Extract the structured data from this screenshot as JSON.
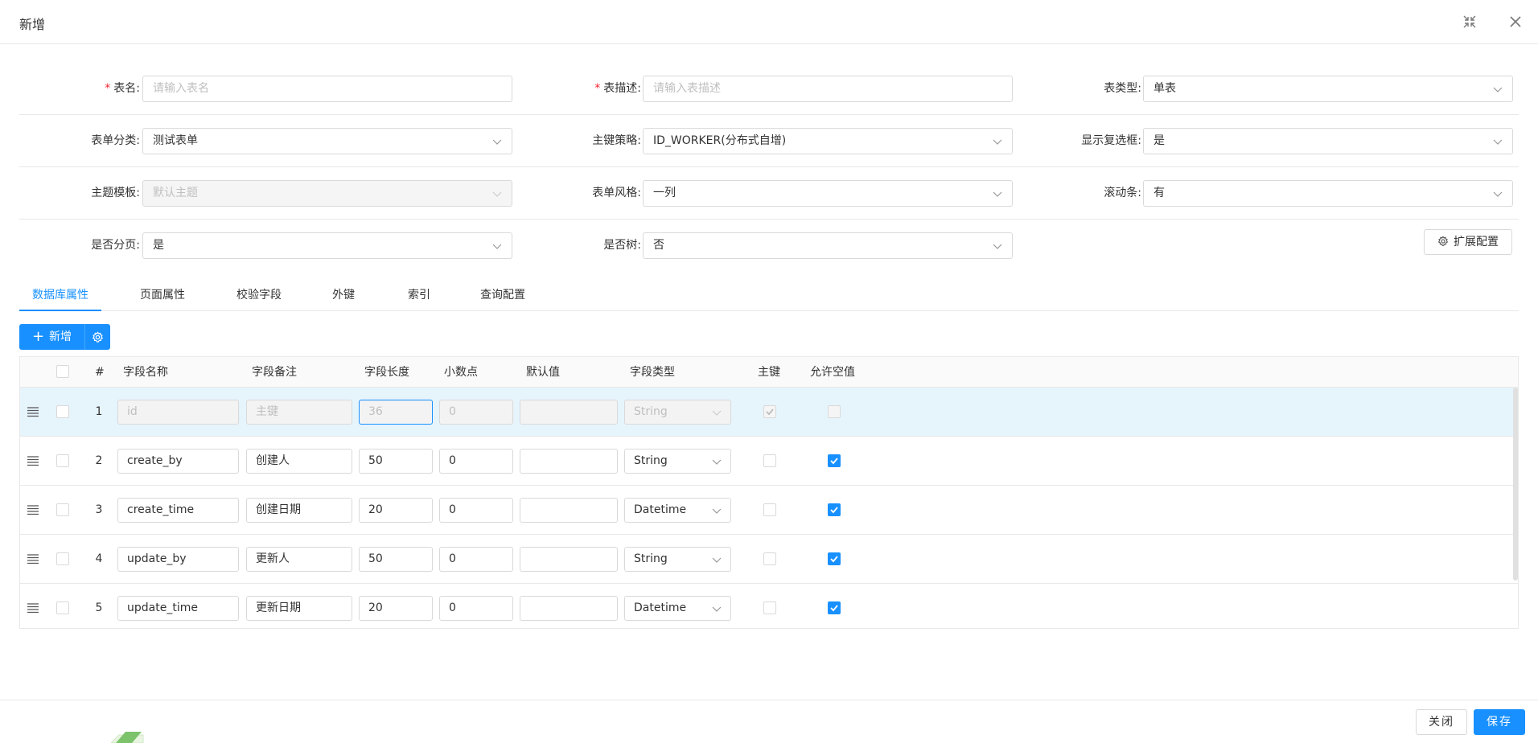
{
  "dialog": {
    "title": "新增"
  },
  "form": {
    "row1": {
      "table_name": {
        "label": "表名:",
        "required": "*",
        "placeholder": "请输入表名"
      },
      "table_desc": {
        "label": "表描述:",
        "required": "*",
        "placeholder": "请输入表描述"
      },
      "table_type": {
        "label": "表类型:",
        "value": "单表"
      }
    },
    "row2": {
      "form_category": {
        "label": "表单分类:",
        "value": "测试表单"
      },
      "pk_strategy": {
        "label": "主键策略:",
        "value": "ID_WORKER(分布式自增)"
      },
      "show_checkbox": {
        "label": "显示复选框:",
        "value": "是"
      }
    },
    "row3": {
      "theme_template": {
        "label": "主题模板:",
        "value": "默认主题"
      },
      "form_style": {
        "label": "表单风格:",
        "value": "一列"
      },
      "scrollbar": {
        "label": "滚动条:",
        "value": "有"
      }
    },
    "row4": {
      "paging": {
        "label": "是否分页:",
        "value": "是"
      },
      "is_tree": {
        "label": "是否树:",
        "value": "否"
      },
      "extend_config_label": "扩展配置"
    }
  },
  "tabs": [
    "数据库属性",
    "页面属性",
    "校验字段",
    "外键",
    "索引",
    "查询配置"
  ],
  "toolbar": {
    "add_label": "新增"
  },
  "table": {
    "headers": {
      "num": "#",
      "name": "字段名称",
      "comment": "字段备注",
      "length": "字段长度",
      "decimal": "小数点",
      "default": "默认值",
      "type": "字段类型",
      "pk": "主键",
      "nullable": "允许空值"
    },
    "rows": [
      {
        "num": "1",
        "name": "id",
        "comment": "主键",
        "length": "36",
        "decimal": "0",
        "default": "",
        "type": "String",
        "pk": true,
        "nullable": false
      },
      {
        "num": "2",
        "name": "create_by",
        "comment": "创建人",
        "length": "50",
        "decimal": "0",
        "default": "",
        "type": "String",
        "pk": false,
        "nullable": true
      },
      {
        "num": "3",
        "name": "create_time",
        "comment": "创建日期",
        "length": "20",
        "decimal": "0",
        "default": "",
        "type": "Datetime",
        "pk": false,
        "nullable": true
      },
      {
        "num": "4",
        "name": "update_by",
        "comment": "更新人",
        "length": "50",
        "decimal": "0",
        "default": "",
        "type": "String",
        "pk": false,
        "nullable": true
      },
      {
        "num": "5",
        "name": "update_time",
        "comment": "更新日期",
        "length": "20",
        "decimal": "0",
        "default": "",
        "type": "Datetime",
        "pk": false,
        "nullable": true
      }
    ]
  },
  "footer": {
    "close_label": "关闭",
    "save_label": "保存"
  },
  "colors": {
    "primary": "#1890ff",
    "selected_row": "#e6f4fc",
    "required": "#f5222d"
  }
}
